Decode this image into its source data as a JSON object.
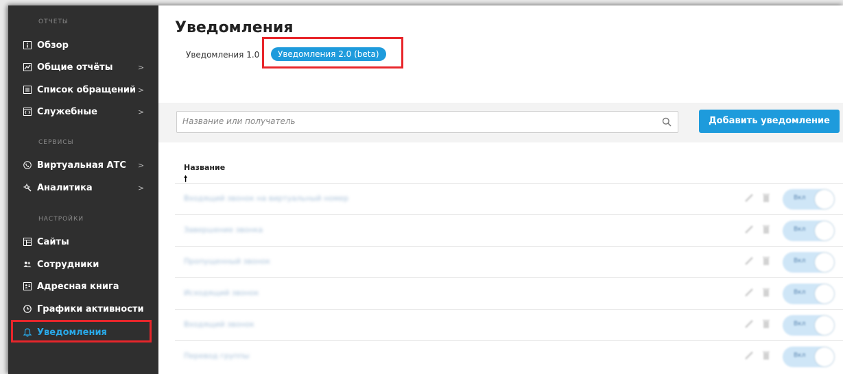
{
  "sidebar": {
    "sections": [
      {
        "title": "ОТЧЕТЫ"
      },
      {
        "title": "СЕРВИСЫ"
      },
      {
        "title": "НАСТРОЙКИ"
      }
    ],
    "items": [
      {
        "label": "Обзор",
        "icon": "overview-icon",
        "arrow": ""
      },
      {
        "label": "Общие отчёты",
        "icon": "chart-icon",
        "arrow": ">"
      },
      {
        "label": "Список обращений",
        "icon": "list-icon",
        "arrow": ">"
      },
      {
        "label": "Служебные",
        "icon": "code-icon",
        "arrow": ">"
      },
      {
        "label": "Виртуальная АТС",
        "icon": "phone-icon",
        "arrow": ">"
      },
      {
        "label": "Аналитика",
        "icon": "analytics-icon",
        "arrow": ">"
      },
      {
        "label": "Сайты",
        "icon": "sites-icon",
        "arrow": ""
      },
      {
        "label": "Сотрудники",
        "icon": "users-icon",
        "arrow": ""
      },
      {
        "label": "Адресная книга",
        "icon": "address-book-icon",
        "arrow": ""
      },
      {
        "label": "Графики активности",
        "icon": "clock-icon",
        "arrow": ""
      },
      {
        "label": "Уведомления",
        "icon": "bell-icon",
        "arrow": ""
      }
    ]
  },
  "main": {
    "title": "Уведомления",
    "tabs": [
      {
        "label": "Уведомления 1.0"
      },
      {
        "label": "Уведомления 2.0 (beta)"
      }
    ],
    "search": {
      "placeholder": "Название или получатель"
    },
    "add_button": "Добавить уведомление",
    "table": {
      "column_header": "Название",
      "sort_arrow": "🠕",
      "rows": [
        {
          "name": "Входящий звонок на виртуальный номер",
          "toggle": "Вкл"
        },
        {
          "name": "Завершение звонка",
          "toggle": "Вкл"
        },
        {
          "name": "Пропущенный звонок",
          "toggle": "Вкл"
        },
        {
          "name": "Исходящий звонок",
          "toggle": "Вкл"
        },
        {
          "name": "Входящий звонок",
          "toggle": "Вкл"
        },
        {
          "name": "Перевод группы",
          "toggle": "Вкл"
        }
      ]
    }
  },
  "colors": {
    "accent": "#1e9bdc",
    "sidebar_bg": "#2f2f2f",
    "highlight": "#e8262b"
  }
}
